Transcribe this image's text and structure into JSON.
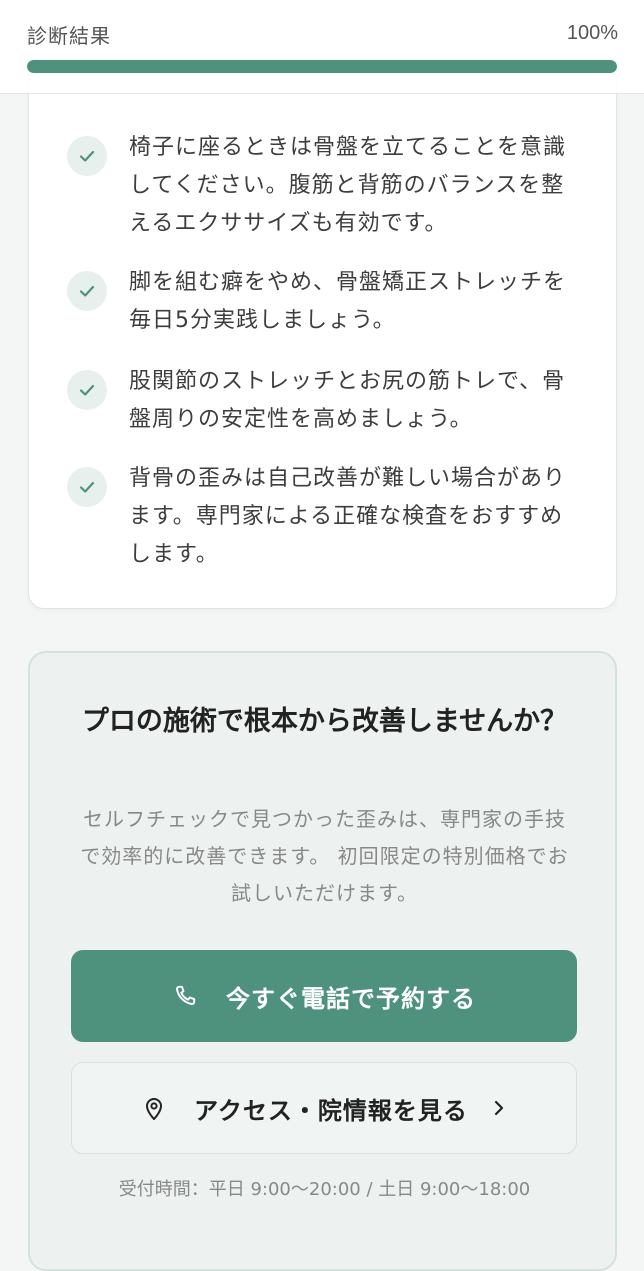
{
  "header": {
    "title": "診断結果",
    "percent_label": "100%",
    "progress": 1.0
  },
  "tips": [
    {
      "text": "椅子に座るときは骨盤を立てることを意識してください。腹筋と背筋のバランスを整えるエクササイズも有効です。"
    },
    {
      "text": "脚を組む癖をやめ、骨盤矯正ストレッチを毎日5分実践しましょう。"
    },
    {
      "text": "股関節のストレッチとお尻の筋トレで、骨盤周りの安定性を高めましょう。"
    },
    {
      "text": "背骨の歪みは自己改善が難しい場合があります。専門家による正確な検査をおすすめします。"
    }
  ],
  "cta": {
    "title": "プロの施術で根本から改善しませんか？",
    "description": "セルフチェックで見つかった歪みは、専門家の手技で効率的に改善できます。 初回限定の特別価格でお試しいただけます。",
    "call_button": "今すぐ電話で予約する",
    "access_button": "アクセス・院情報を見る",
    "hours": "受付時間：平日 9:00〜20:00 / 土日 9:00〜18:00"
  },
  "colors": {
    "accent": "#4e927d",
    "check_bg": "#e7f0ec",
    "cta_bg": "#edf2f0"
  },
  "icons": {
    "tip": "check-icon",
    "call": "phone-icon",
    "access": "map-pin-icon",
    "chevron": "chevron-right-icon"
  }
}
